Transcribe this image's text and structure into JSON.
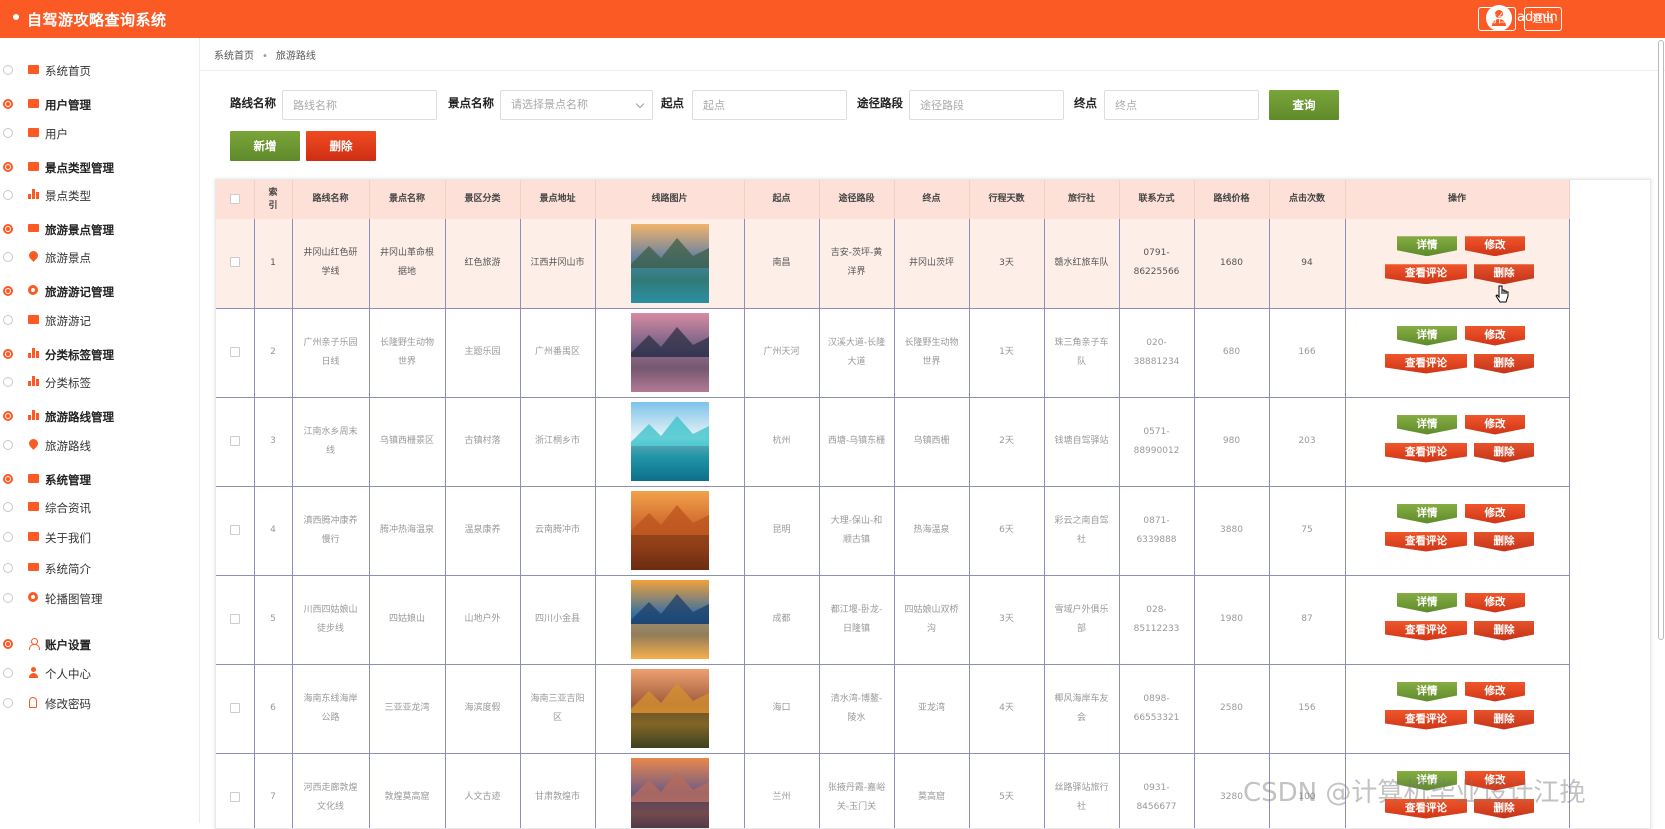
{
  "header": {
    "app_title": "自驾游攻略查询系统",
    "username": "admin",
    "frontend_btn": "前台",
    "logout_btn": "退出",
    "brand_color": "#fb5a25"
  },
  "sidebar": {
    "items": [
      {
        "label": "系统首页",
        "icon": "briefcase-icon",
        "group": false
      },
      {
        "label": "用户管理",
        "icon": "briefcase-icon",
        "group": true
      },
      {
        "label": "用户",
        "icon": "briefcase-icon",
        "group": false
      },
      {
        "label": "景点类型管理",
        "icon": "clipboard-icon",
        "group": true
      },
      {
        "label": "景点类型",
        "icon": "bar-chart-icon",
        "group": false
      },
      {
        "label": "旅游景点管理",
        "icon": "monitor-icon",
        "group": true
      },
      {
        "label": "旅游景点",
        "icon": "map-pin-icon",
        "group": false
      },
      {
        "label": "旅游游记管理",
        "icon": "gear-icon",
        "group": true
      },
      {
        "label": "旅游游记",
        "icon": "briefcase-icon",
        "group": false
      },
      {
        "label": "分类标签管理",
        "icon": "bar-chart-icon",
        "group": true
      },
      {
        "label": "分类标签",
        "icon": "bar-chart-icon",
        "group": false
      },
      {
        "label": "旅游路线管理",
        "icon": "area-chart-icon",
        "group": true
      },
      {
        "label": "旅游路线",
        "icon": "map-pin-icon",
        "group": false
      },
      {
        "label": "系统管理",
        "icon": "columns-icon",
        "group": true
      },
      {
        "label": "综合资讯",
        "icon": "briefcase-icon",
        "group": false
      },
      {
        "label": "关于我们",
        "icon": "clipboard-icon",
        "group": false
      },
      {
        "label": "系统简介",
        "icon": "monitor-icon",
        "group": false
      },
      {
        "label": "轮播图管理",
        "icon": "gear-icon",
        "group": false
      },
      {
        "label": "账户设置",
        "icon": "user-outline-icon",
        "group": true
      },
      {
        "label": "个人中心",
        "icon": "user-icon",
        "group": false
      },
      {
        "label": "修改密码",
        "icon": "lock-icon",
        "group": false
      }
    ]
  },
  "breadcrumb": {
    "home": "系统首页",
    "separator": "•",
    "current": "旅游路线"
  },
  "filters": {
    "route_name_label": "路线名称",
    "route_name_placeholder": "路线名称",
    "spot_name_label": "景点名称",
    "spot_name_placeholder": "请选择景点名称",
    "start_label": "起点",
    "start_placeholder": "起点",
    "via_label": "途径路段",
    "via_placeholder": "途径路段",
    "end_label": "终点",
    "end_placeholder": "终点",
    "query_btn": "查询",
    "add_btn": "新增",
    "delete_btn": "删除"
  },
  "table": {
    "headers": [
      "",
      "索引",
      "路线名称",
      "景点名称",
      "景区分类",
      "景点地址",
      "线路图片",
      "起点",
      "途径路段",
      "终点",
      "行程天数",
      "旅行社",
      "联系方式",
      "路线价格",
      "点击次数",
      "操作"
    ],
    "actions": {
      "detail": "详情",
      "edit": "修改",
      "review": "查看评论",
      "delete": "删除"
    },
    "rows": [
      {
        "index": "1",
        "route": "井冈山红色研学线",
        "spot": "井冈山革命根据地",
        "category": "红色旅游",
        "address": "江西井冈山市",
        "image": "mountain-lake-photo",
        "start": "南昌",
        "via": "吉安-茨坪-黄洋界",
        "end": "井冈山茨坪",
        "days": "3天",
        "agency": "赣水红旅车队",
        "contact": "0791-86225566",
        "price": "1680",
        "clicks": "94"
      },
      {
        "index": "2",
        "route": "广州亲子乐园日线",
        "spot": "长隆野生动物世界",
        "category": "主题乐园",
        "address": "广州番禺区",
        "image": "volcano-lake-photo",
        "start": "广州天河",
        "via": "汉溪大道-长隆大道",
        "end": "长隆野生动物世界",
        "days": "1天",
        "agency": "珠三角亲子车队",
        "contact": "020-38881234",
        "price": "680",
        "clicks": "166"
      },
      {
        "index": "3",
        "route": "江南水乡周末线",
        "spot": "乌镇西栅景区",
        "category": "古镇村落",
        "address": "浙江桐乡市",
        "image": "tropical-beach-photo",
        "start": "杭州",
        "via": "西塘-乌镇东栅",
        "end": "乌镇西栅",
        "days": "2天",
        "agency": "钱塘自驾驿站",
        "contact": "0571-88990012",
        "price": "980",
        "clicks": "203"
      },
      {
        "index": "4",
        "route": "滇西腾冲康养慢行",
        "spot": "腾冲热海温泉",
        "category": "温泉康养",
        "address": "云南腾冲市",
        "image": "desert-tree-photo",
        "start": "昆明",
        "via": "大理-保山-和顺古镇",
        "end": "热海温泉",
        "days": "6天",
        "agency": "彩云之南自驾社",
        "contact": "0871-6339888",
        "price": "3880",
        "clicks": "75"
      },
      {
        "index": "5",
        "route": "川西四姑娘山徒步线",
        "spot": "四姑娘山",
        "category": "山地户外",
        "address": "四川小金县",
        "image": "sunset-lake-photo",
        "start": "成都",
        "via": "都江堰-卧龙-日隆镇",
        "end": "四姑娘山双桥沟",
        "days": "3天",
        "agency": "雪域户外俱乐部",
        "contact": "028-85112233",
        "price": "1980",
        "clicks": "87"
      },
      {
        "index": "6",
        "route": "海南东线海岸公路",
        "spot": "三亚亚龙湾",
        "category": "海滨度假",
        "address": "海南三亚吉阳区",
        "image": "mountain-meadow-photo",
        "start": "海口",
        "via": "清水湾-博鳌-陵水",
        "end": "亚龙湾",
        "days": "4天",
        "agency": "椰风海岸车友会",
        "contact": "0898-66553321",
        "price": "2580",
        "clicks": "156"
      },
      {
        "index": "7",
        "route": "河西走廊敦煌文化线",
        "spot": "敦煌莫高窟",
        "category": "人文古迹",
        "address": "甘肃敦煌市",
        "image": "dusk-sky-photo",
        "start": "兰州",
        "via": "张掖丹霞-嘉峪关-玉门关",
        "end": "莫高窟",
        "days": "5天",
        "agency": "丝路驿站旅行社",
        "contact": "0931-8456677",
        "price": "3280",
        "clicks": "100"
      }
    ]
  },
  "watermark": "CSDN @计算机毕业设计江挽"
}
